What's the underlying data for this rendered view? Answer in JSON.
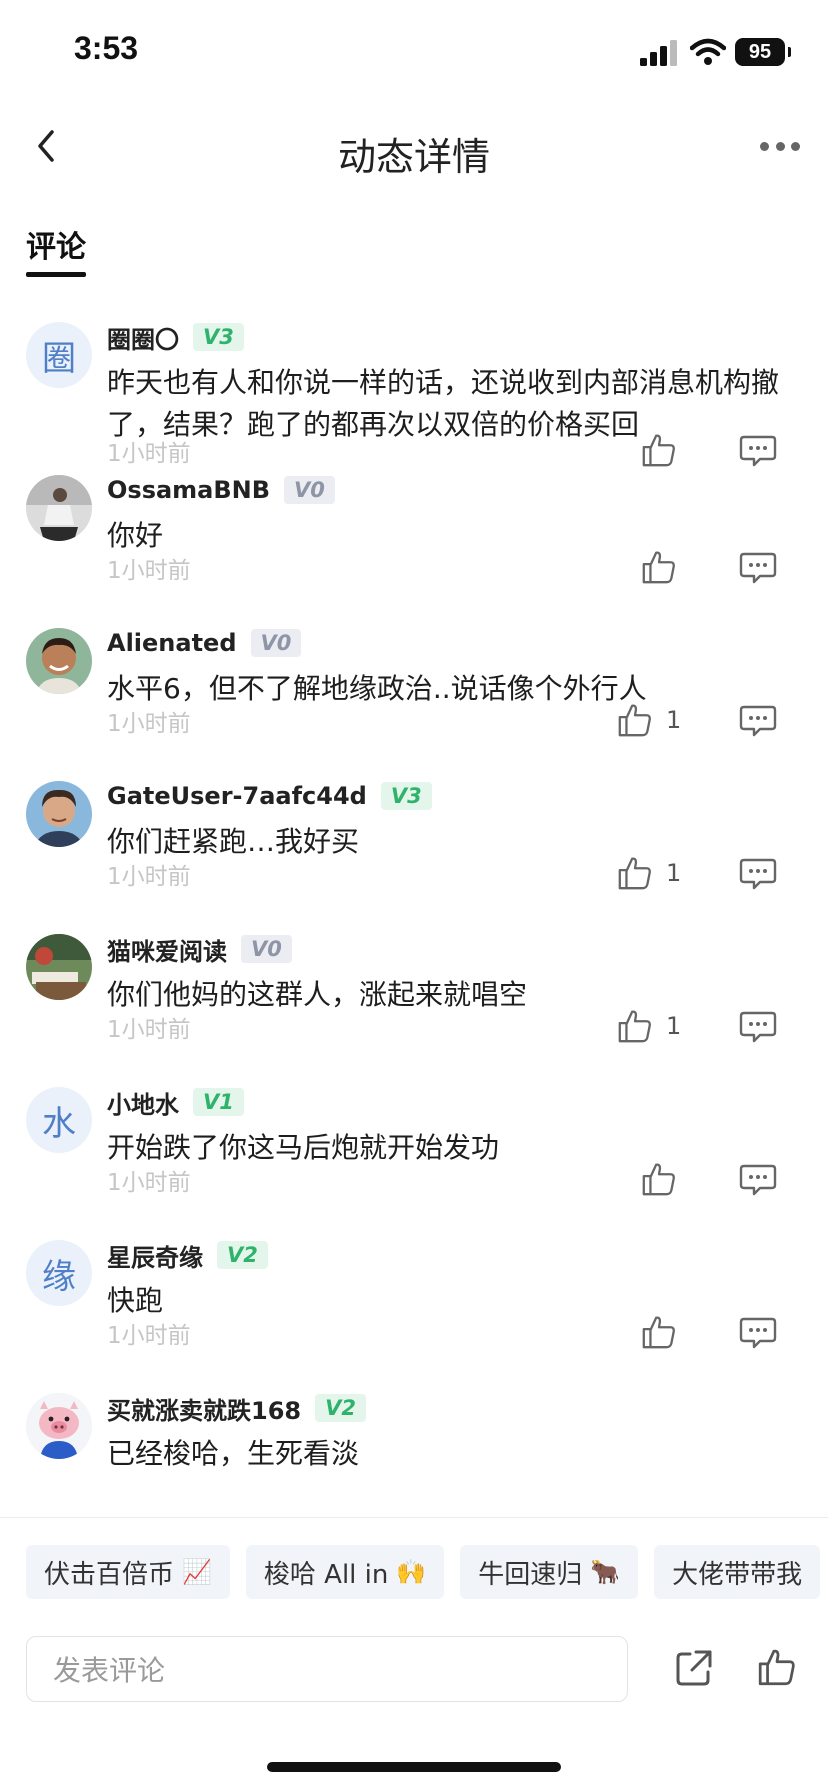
{
  "status_bar": {
    "time": "3:53",
    "battery": "95"
  },
  "nav": {
    "title": "动态详情"
  },
  "tabs": {
    "comments": "评论"
  },
  "comments": [
    {
      "username": "圈圈〇",
      "avatar_char": "圈",
      "level": "V3",
      "level_style": "green",
      "text": "昨天也有人和你说一样的话，还说收到内部消息机构撤了，结果？跑了的都再次以双倍的价格买回",
      "time": "1小时前",
      "likes": ""
    },
    {
      "username": "OssamaBNB",
      "avatar_char": "",
      "level": "V0",
      "level_style": "gray",
      "text": "你好",
      "time": "1小时前",
      "likes": ""
    },
    {
      "username": "Alienated",
      "avatar_char": "",
      "level": "V0",
      "level_style": "gray",
      "text": "水平6，但不了解地缘政治..说话像个外行人",
      "time": "1小时前",
      "likes": "1"
    },
    {
      "username": "GateUser-7aafc44d",
      "avatar_char": "",
      "level": "V3",
      "level_style": "green",
      "text": "你们赶紧跑…我好买",
      "time": "1小时前",
      "likes": "1"
    },
    {
      "username": "猫咪爱阅读",
      "avatar_char": "",
      "level": "V0",
      "level_style": "gray",
      "text": "你们他妈的这群人，涨起来就唱空",
      "time": "1小时前",
      "likes": "1"
    },
    {
      "username": "小地水",
      "avatar_char": "水",
      "level": "V1",
      "level_style": "green",
      "text": "开始跌了你这马后炮就开始发功",
      "time": "1小时前",
      "likes": ""
    },
    {
      "username": "星辰奇缘",
      "avatar_char": "缘",
      "level": "V2",
      "level_style": "green",
      "text": "快跑",
      "time": "1小时前",
      "likes": ""
    },
    {
      "username": "买就涨卖就跌168",
      "avatar_char": "",
      "level": "V2",
      "level_style": "green",
      "text": "已经梭哈，生死看淡",
      "time": "",
      "likes": ""
    }
  ],
  "quick_replies": [
    {
      "label": "伏击百倍币",
      "emoji": "📈"
    },
    {
      "label": "梭哈 All in",
      "emoji": "🙌"
    },
    {
      "label": "牛回速归",
      "emoji": "🐂"
    },
    {
      "label": "大佬带带我",
      "emoji": ""
    }
  ],
  "input": {
    "placeholder": "发表评论"
  },
  "icons": {
    "back": "back-arrow-icon",
    "more": "more-dots-icon",
    "like": "thumbs-up-icon",
    "reply": "comment-bubble-icon",
    "share": "share-icon"
  },
  "colors": {
    "level_green": "#2fb36b",
    "level_gray": "#8e95a6",
    "timestamp": "#c6c6c6"
  }
}
